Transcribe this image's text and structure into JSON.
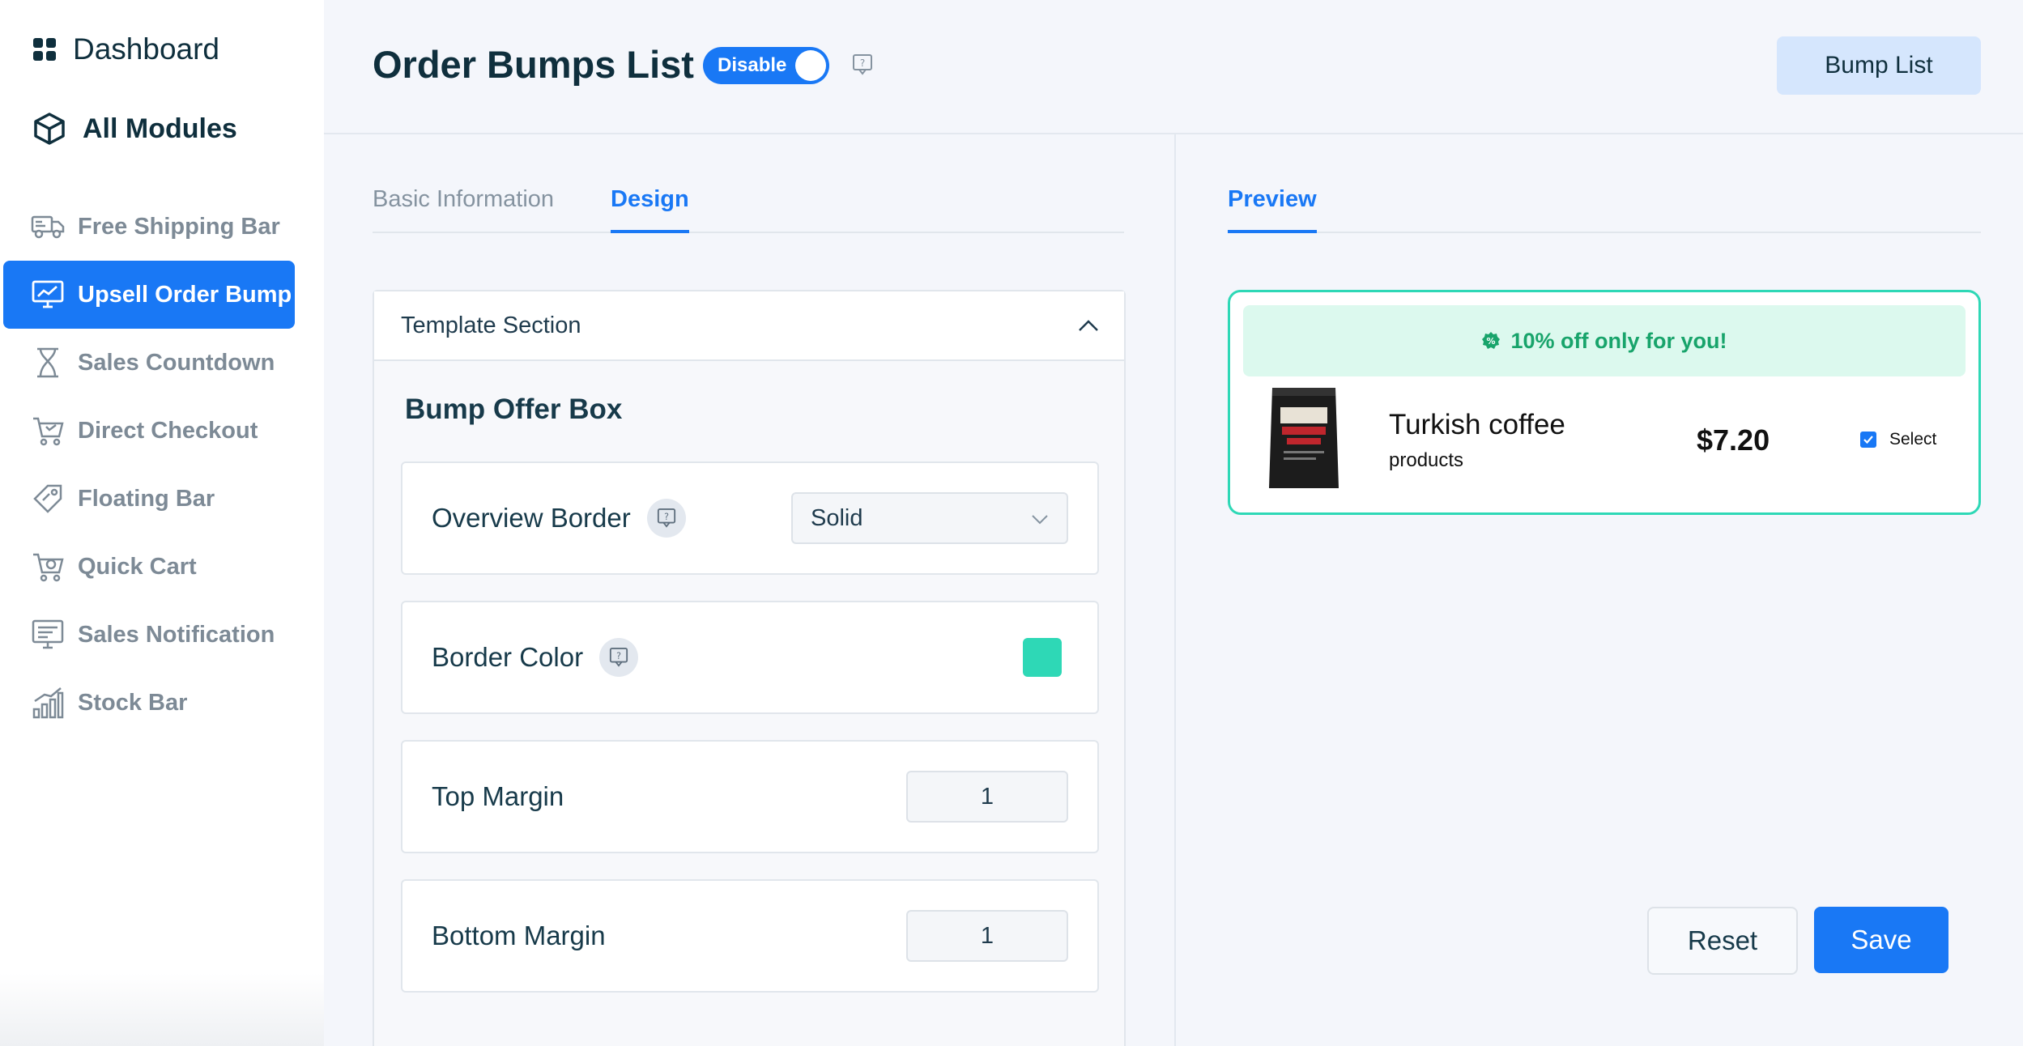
{
  "sidebar": {
    "dashboard": "Dashboard",
    "all_modules": "All Modules",
    "items": [
      {
        "label": "Free Shipping Bar",
        "icon": "truck-icon"
      },
      {
        "label": "Upsell Order Bump",
        "icon": "chart-monitor-icon",
        "active": true
      },
      {
        "label": "Sales Countdown",
        "icon": "hourglass-icon"
      },
      {
        "label": "Direct Checkout",
        "icon": "cart-icon"
      },
      {
        "label": "Floating Bar",
        "icon": "tag-icon"
      },
      {
        "label": "Quick Cart",
        "icon": "cart-plus-icon"
      },
      {
        "label": "Sales Notification",
        "icon": "notification-icon"
      },
      {
        "label": "Stock Bar",
        "icon": "bar-chart-icon"
      }
    ]
  },
  "header": {
    "title": "Order Bumps List",
    "toggle_label": "Disable",
    "bump_list_button": "Bump List"
  },
  "tabs": {
    "basic": "Basic Information",
    "design": "Design",
    "preview": "Preview"
  },
  "template": {
    "section_title": "Template Section",
    "bump_offer_title": "Bump Offer Box",
    "overview_border_label": "Overview Border",
    "overview_border_value": "Solid",
    "border_color_label": "Border Color",
    "border_color_value": "#2ed8b6",
    "top_margin_label": "Top Margin",
    "top_margin_value": "1",
    "bottom_margin_label": "Bottom Margin",
    "bottom_margin_value": "1"
  },
  "preview": {
    "offer_text": "10% off only for you!",
    "product_name": "Turkish coffee",
    "product_category": "products",
    "price": "$7.20",
    "select_label": "Select"
  },
  "actions": {
    "reset": "Reset",
    "save": "Save"
  },
  "colors": {
    "accent": "#1978f5",
    "border_preview": "#2ed8b6",
    "offer_green": "#18a46b"
  }
}
